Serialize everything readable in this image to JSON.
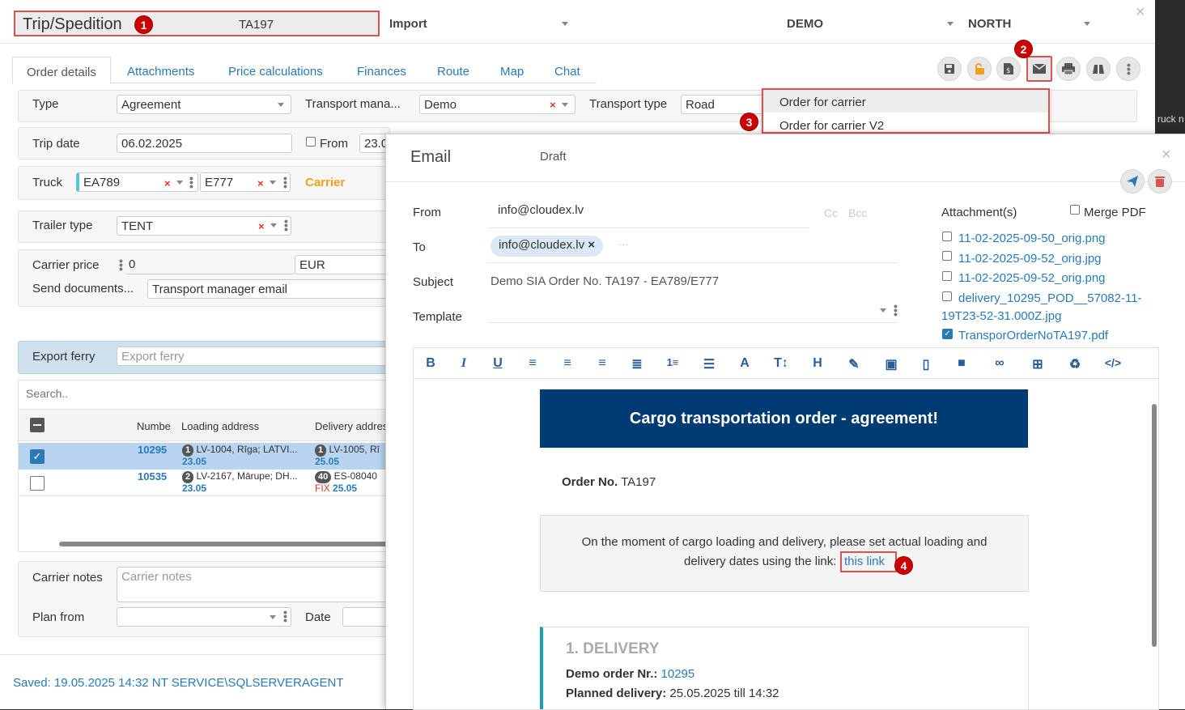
{
  "header": {
    "title": "Trip/Spedition",
    "code": "TA197",
    "import_label": "Import",
    "company": "DEMO",
    "region": "NORTH"
  },
  "tabs": [
    "Order details",
    "Attachments",
    "Price calculations",
    "Finances",
    "Route",
    "Map",
    "Chat"
  ],
  "dropdown": {
    "items": [
      "Order for carrier",
      "Order for carrier V2"
    ]
  },
  "form": {
    "type_label": "Type",
    "type_value": "Agreement",
    "tm_label": "Transport mana...",
    "tm_value": "Demo",
    "tt_label": "Transport type",
    "tt_value": "Road",
    "trip_date_label": "Trip date",
    "trip_date_value": "06.02.2025",
    "from_label": "From",
    "from_value": "23.0",
    "truck_label": "Truck",
    "truck_value": "EA789",
    "trailer_value": "E777",
    "carrier_label": "Carrier",
    "trailer_type_label": "Trailer type",
    "trailer_type_value": "TENT",
    "carrier_price_label": "Carrier price",
    "carrier_price_value": "0",
    "currency": "EUR",
    "send_docs_label": "Send documents...",
    "send_docs_value": "Transport manager email",
    "export_ferry_label": "Export ferry",
    "export_ferry_placeholder": "Export ferry",
    "search_placeholder": "Search..",
    "carrier_notes_label": "Carrier notes",
    "carrier_notes_placeholder": "Carrier notes",
    "plan_from_label": "Plan from",
    "date_label": "Date"
  },
  "grid": {
    "headers": [
      "Numbe",
      "Loading address",
      "Delivery addres"
    ],
    "rows": [
      {
        "number": "10295",
        "load_badge": "1",
        "load_addr": "LV-1004, Rīga; LATVI...",
        "load_date": "23.05",
        "del_badge": "1",
        "del_addr": "LV-1005, Rī",
        "del_date": "25.05",
        "fix": ""
      },
      {
        "number": "10535",
        "load_badge": "2",
        "load_addr": "LV-2167, Mārupe; DH...",
        "load_date": "23.05",
        "del_badge": "40",
        "del_addr": "ES-08040",
        "del_date": "25.05",
        "fix": "FIX"
      }
    ]
  },
  "saved_text": "Saved: 19.05.2025 14:32 NT SERVICE\\SQLSERVERAGENT",
  "email": {
    "title": "Email",
    "status": "Draft",
    "from_label": "From",
    "from_value": "info@cloudex.lv",
    "cc": "Cc",
    "bcc": "Bcc",
    "to_label": "To",
    "to_chip": "info@cloudex.lv",
    "subject_label": "Subject",
    "subject_value": "Demo SIA Order No. TA197 - EA789/E777",
    "template_label": "Template",
    "attachments_label": "Attachment(s)",
    "merge_pdf": "Merge PDF",
    "attachments": [
      "11-02-2025-09-50_orig.png",
      "11-02-2025-09-52_orig.jpg",
      "11-02-2025-09-52_orig.png",
      "delivery_10295_POD__57082-11-",
      "19T23-52-31.000Z.jpg",
      "TransporOrderNoTA197.pdf"
    ],
    "body": {
      "banner": "Cargo transportation order - agreement!",
      "order_label": "Order No.",
      "order_no": "TA197",
      "notice_line1": "On the moment of cargo loading and delivery, please set actual loading and",
      "notice_line2": "delivery dates using the link:",
      "link_text": "this link",
      "delivery_title": "1. DELIVERY",
      "demo_order_label": "Demo order Nr.:",
      "demo_order_no": "10295",
      "planned_label": "Planned delivery:",
      "planned_value": "25.05.2025 till 14:32"
    }
  },
  "badges": [
    "1",
    "2",
    "3",
    "4"
  ],
  "colors": {
    "accent": "#2a7ab8",
    "banner": "#003b73",
    "annotation": "#d9534f",
    "carrier": "#f0a020"
  }
}
